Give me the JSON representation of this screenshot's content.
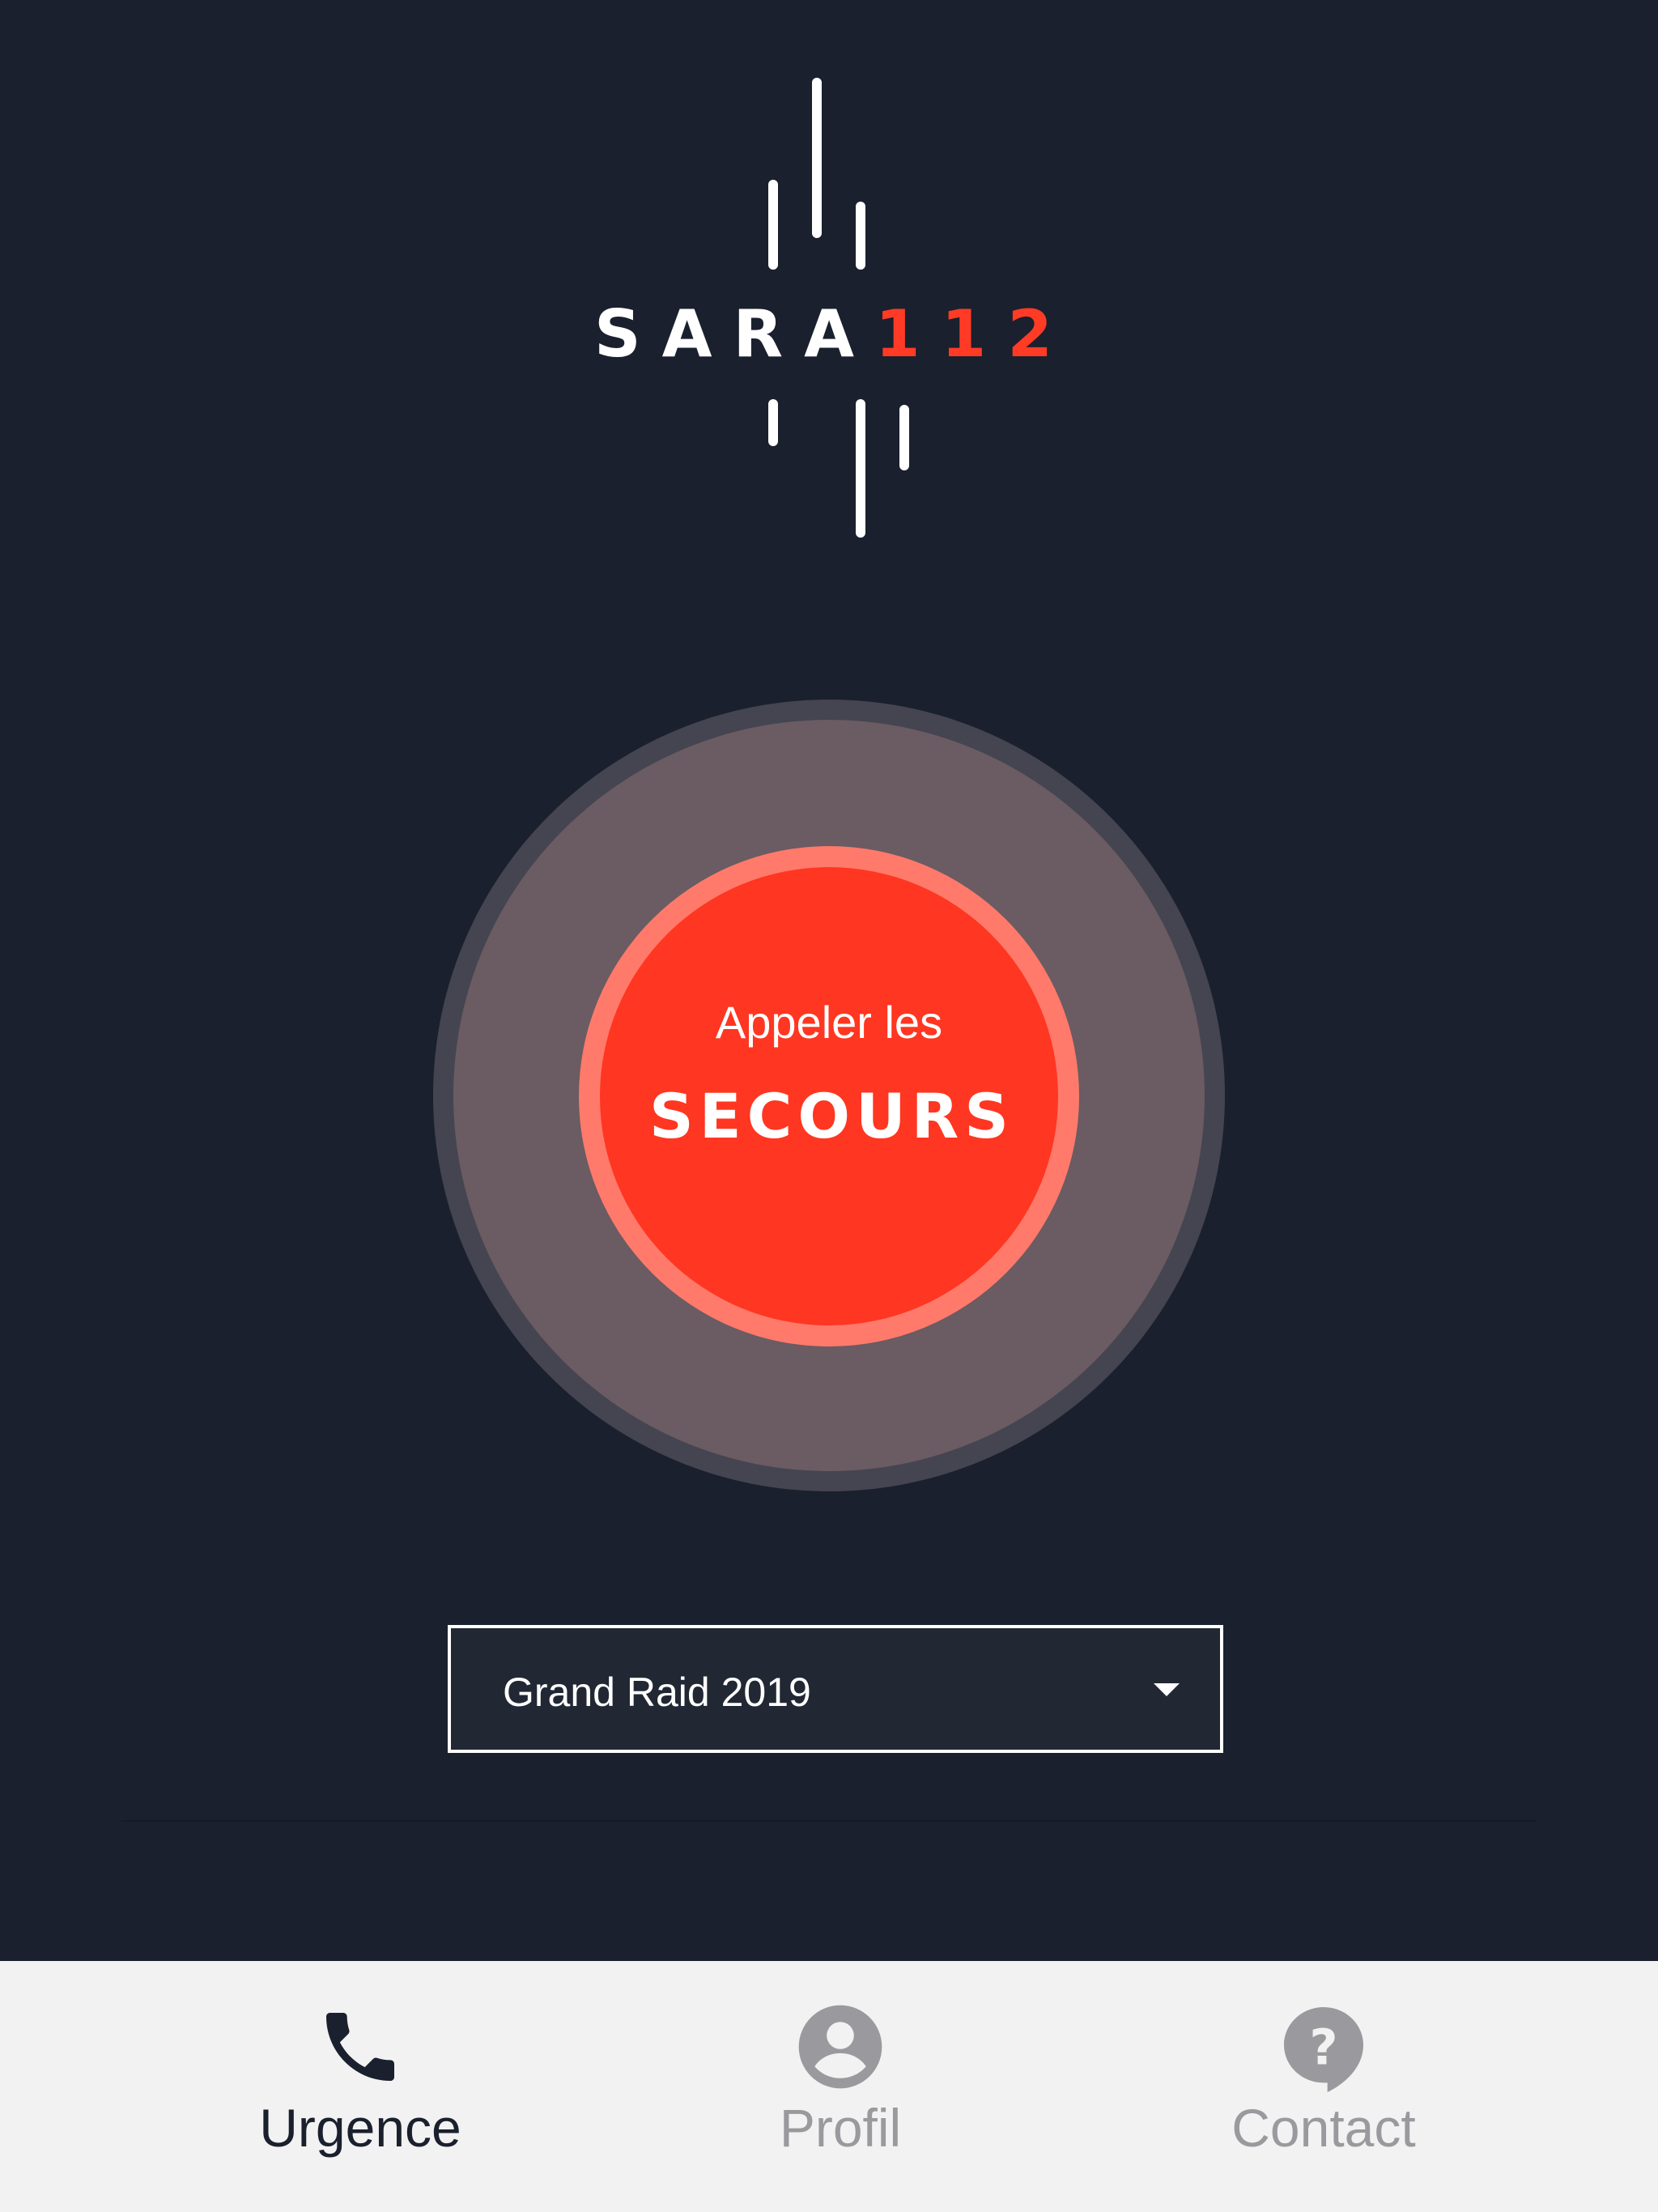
{
  "app": {
    "logo_text": "SARA",
    "logo_number": "112"
  },
  "emergency_button": {
    "line1": "Appeler les",
    "line2": "SECOURS"
  },
  "event_selector": {
    "selected": "Grand Raid 2019"
  },
  "tabs": [
    {
      "label": "Urgence",
      "icon": "phone-icon",
      "active": true
    },
    {
      "label": "Profil",
      "icon": "account-icon",
      "active": false
    },
    {
      "label": "Contact",
      "icon": "help-bubble-icon",
      "active": false
    }
  ],
  "colors": {
    "background": "#1a202d",
    "accent": "#ff3621",
    "accent_ring": "#ff7a6b",
    "tab_bar": "#f2f2f2",
    "tab_active": "#1a202d",
    "tab_inactive": "#9a9a9e"
  }
}
